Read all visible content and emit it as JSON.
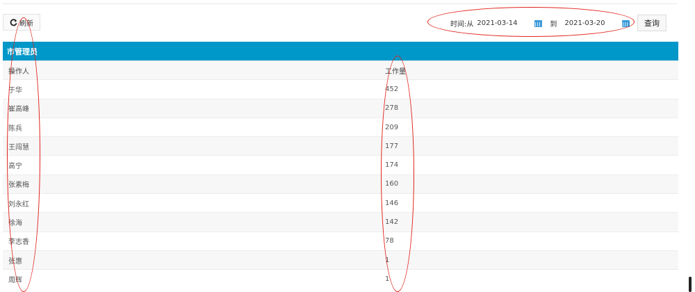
{
  "toolbar": {
    "refresh_label": "刷新",
    "time_from_label": "时间:从",
    "start_date": "2021-03-14",
    "to_label": "到",
    "end_date": "2021-03-20",
    "query_label": "查询"
  },
  "panel": {
    "title": "市管理员",
    "columns": [
      "操作人",
      "工作量"
    ],
    "rows": [
      {
        "name": "于华",
        "count": "452"
      },
      {
        "name": "崔高峰",
        "count": "278"
      },
      {
        "name": "陈兵",
        "count": "209"
      },
      {
        "name": "王闯慧",
        "count": "177"
      },
      {
        "name": "高宁",
        "count": "174"
      },
      {
        "name": "张素梅",
        "count": "160"
      },
      {
        "name": "刘永红",
        "count": "146"
      },
      {
        "name": "徐海",
        "count": "142"
      },
      {
        "name": "李志香",
        "count": "78"
      },
      {
        "name": "张惠",
        "count": "1"
      },
      {
        "name": "周辉",
        "count": "1"
      }
    ]
  },
  "colors": {
    "header_blue": "#0097c9",
    "annotation_red": "#e0231b",
    "calendar_icon": "#3a9ad9"
  }
}
